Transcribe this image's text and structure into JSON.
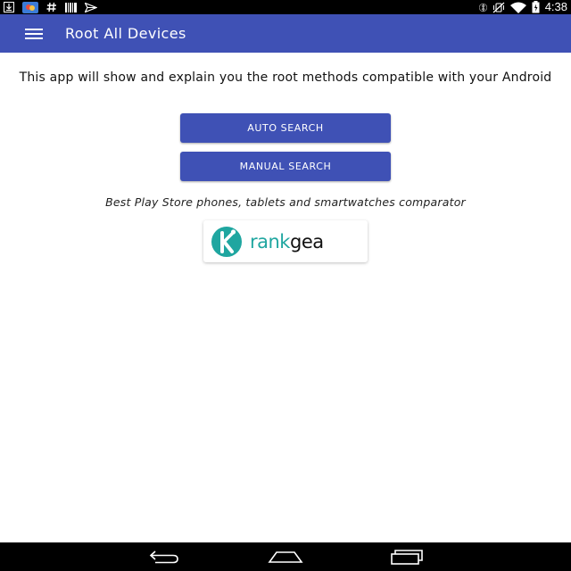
{
  "status_bar": {
    "time": "4:38",
    "left_icons": [
      "download-icon",
      "photos-app-icon",
      "hash-icon",
      "barcode-icon",
      "send-icon"
    ],
    "right_icons": [
      "bluetooth-icon",
      "vibrate-icon",
      "wifi-icon",
      "battery-icon"
    ]
  },
  "app_bar": {
    "title": "Root All Devices",
    "menu_icon": "hamburger-menu-icon",
    "color": "#3f51b5"
  },
  "main": {
    "intro_text": "This app will show and explain you the root methods compatible with your Android",
    "auto_search_label": "AUTO SEARCH",
    "manual_search_label": "MANUAL SEARCH",
    "tagline": "Best Play Store phones, tablets and smartwatches comparator",
    "logo": {
      "text_part_1": "rank",
      "text_part_2": "gea",
      "accent_color": "#1fa6a0"
    }
  },
  "nav_bar": {
    "icons": [
      "back-icon",
      "home-icon",
      "recent-apps-icon"
    ]
  }
}
